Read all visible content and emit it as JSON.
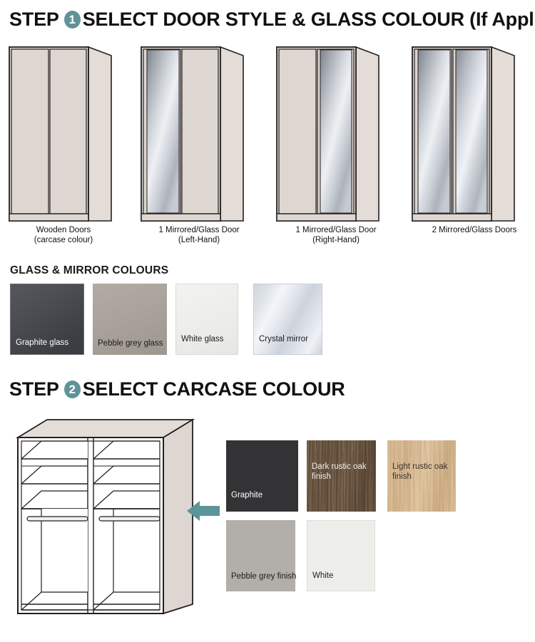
{
  "step1": {
    "step_word": "STEP",
    "badge": "1",
    "title": "SELECT DOOR STYLE & GLASS COLOUR (If Applicable)",
    "badge_color": "#5f9398",
    "doors": [
      {
        "name": "wooden-doors",
        "line1": "Wooden Doors",
        "line2": "(carcase colour)"
      },
      {
        "name": "mirror-left-hand",
        "line1": "1 Mirrored/Glass Door",
        "line2": "(Left-Hand)"
      },
      {
        "name": "mirror-right-hand",
        "line1": "1 Mirrored/Glass Door",
        "line2": "(Right-Hand)"
      },
      {
        "name": "two-mirrored-doors",
        "line1": "2 Mirrored/Glass Doors",
        "line2": ""
      }
    ]
  },
  "glass_section": {
    "heading": "GLASS & MIRROR COLOURS",
    "swatches": [
      {
        "name": "graphite-glass",
        "label": "Graphite glass",
        "color": "#3f4246"
      },
      {
        "name": "pebble-grey-glass",
        "label": "Pebble grey glass",
        "color": "#a9a29a"
      },
      {
        "name": "white-glass",
        "label": "White glass",
        "color": "#ececea"
      },
      {
        "name": "crystal-mirror",
        "label": "Crystal mirror",
        "color": "#dde2e9"
      }
    ]
  },
  "step2": {
    "step_word": "STEP",
    "badge": "2",
    "title": "SELECT CARCASE COLOUR",
    "badge_color": "#5f9398",
    "arrow_color": "#5f9398",
    "swatches": [
      {
        "name": "graphite",
        "label": "Graphite",
        "color": "#333335"
      },
      {
        "name": "dark-rustic-oak",
        "label": "Dark rustic oak finish",
        "color": "#7c6650"
      },
      {
        "name": "light-rustic-oak",
        "label": "Light rustic oak finish",
        "color": "#dcbd95"
      },
      {
        "name": "pebble-grey",
        "label": "Pebble grey finish",
        "color": "#b2aeaa"
      },
      {
        "name": "white",
        "label": "White",
        "color": "#edeeea"
      }
    ]
  },
  "palette": {
    "carcase_face": "#ded7d1",
    "carcase_side": "#e2dbd5",
    "outline": "#231f20"
  }
}
